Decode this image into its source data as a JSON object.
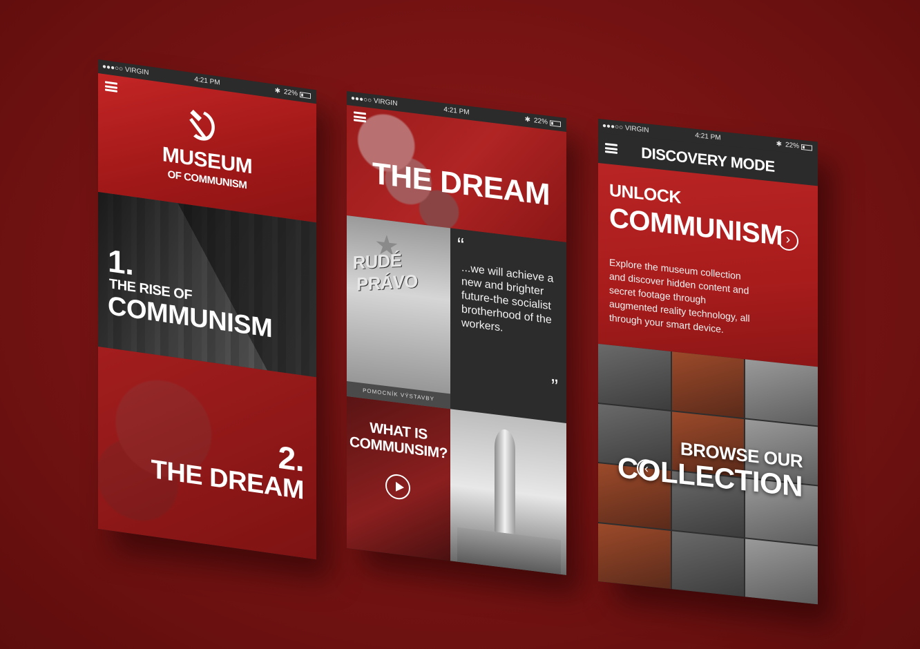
{
  "screens": [
    {
      "status": {
        "carrier": "●●●○○ VIRGIN",
        "wifi_icon": "wifi-icon",
        "time": "4:21 PM",
        "bluetooth": "✱",
        "battery": "22%"
      },
      "logo": {
        "title": "MUSEUM",
        "subtitle": "OF COMMUNISM",
        "icon": "hammer-sickle-icon"
      },
      "sections": [
        {
          "number": "1.",
          "line1": "THE RISE OF",
          "line2": "COMMUNISM"
        },
        {
          "number": "2.",
          "line1": "THE DREAM"
        }
      ]
    },
    {
      "status": {
        "carrier": "●●●○○ VIRGIN",
        "time": "4:21 PM",
        "bluetooth": "✱",
        "battery": "22%"
      },
      "title": "THE DREAM",
      "poster": {
        "title": "RUDÉ PRÁVO",
        "caption": "POMOCNÍK VÝSTAVBY SOCIALISMU !"
      },
      "quote": {
        "open": "“",
        "text": "...we will achieve a new and brighter future-the socialist brotherhood of the workers.",
        "close": "”"
      },
      "video": {
        "label_line1": "WHAT IS",
        "label_line2": "COMMUNSIM?"
      }
    },
    {
      "status": {
        "carrier": "●●●○○ VIRGIN",
        "time": "4:21 PM",
        "bluetooth": "✱",
        "battery": "22%"
      },
      "title": "DISCOVERY MODE",
      "unlock": "UNLOCK",
      "heading": "COMMUNISM",
      "next_arrow": "›",
      "description": "Explore the museum collection and discover hidden content and secret footage through augmented reality technology, all through your smart device.",
      "browse_line1": "BROWSE OUR",
      "browse_line2": "COLLECTION",
      "prev_arrow": "‹"
    }
  ]
}
